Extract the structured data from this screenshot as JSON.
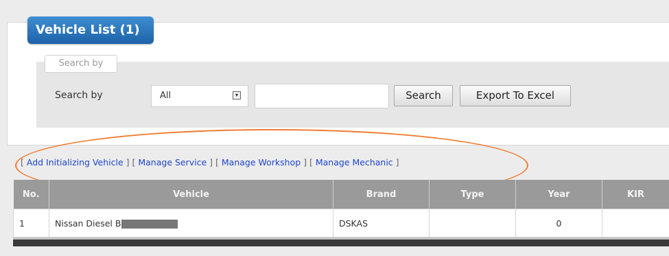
{
  "panel": {
    "title": "Vehicle List (1)"
  },
  "search": {
    "legend": "Search by",
    "label": "Search by",
    "select_value": "All",
    "input_value": "",
    "search_button": "Search",
    "export_button": "Export To Excel"
  },
  "links": [
    "Add Initializing Vehicle",
    "Manage Service",
    "Manage Workshop",
    "Manage Mechanic"
  ],
  "table": {
    "columns": [
      "No.",
      "Vehicle",
      "Brand",
      "Type",
      "Year",
      "KIR"
    ],
    "rows": [
      {
        "no": "1",
        "vehicle": "Nissan Diesel B",
        "brand": "DSKAS",
        "type": "",
        "year": "0",
        "kir": ""
      }
    ]
  },
  "colors": {
    "tab_blue": "#1d62a8",
    "link_blue": "#1e46c8",
    "highlight_orange": "#f07a2e",
    "header_gray": "#9a9a9a"
  }
}
